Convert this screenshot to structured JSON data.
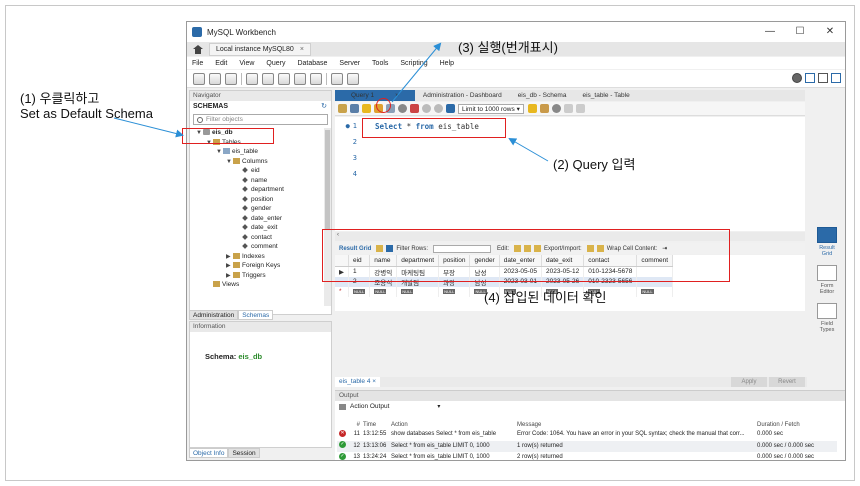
{
  "window": {
    "title": "MySQL Workbench",
    "controls": [
      "—",
      "☐",
      "✕"
    ]
  },
  "connection_tab": {
    "label": "Local instance MySQL80",
    "close": "×"
  },
  "menu": [
    "File",
    "Edit",
    "View",
    "Query",
    "Database",
    "Server",
    "Tools",
    "Scripting",
    "Help"
  ],
  "navigator": {
    "header": "Navigator",
    "schemas_label": "SCHEMAS",
    "filter_placeholder": "Filter objects",
    "tree": [
      {
        "label": "eis_db",
        "toggle": "▼",
        "icon": "db",
        "indent": 0,
        "bold": true
      },
      {
        "label": "Tables",
        "toggle": "▼",
        "icon": "folder",
        "indent": 1
      },
      {
        "label": "eis_table",
        "toggle": "▼",
        "icon": "table",
        "indent": 2
      },
      {
        "label": "Columns",
        "toggle": "▼",
        "icon": "folder",
        "indent": 3
      },
      {
        "label": "eid",
        "toggle": "",
        "icon": "column",
        "indent": 4
      },
      {
        "label": "name",
        "toggle": "",
        "icon": "column",
        "indent": 4
      },
      {
        "label": "department",
        "toggle": "",
        "icon": "column",
        "indent": 4
      },
      {
        "label": "position",
        "toggle": "",
        "icon": "column",
        "indent": 4
      },
      {
        "label": "gender",
        "toggle": "",
        "icon": "column",
        "indent": 4
      },
      {
        "label": "date_enter",
        "toggle": "",
        "icon": "column",
        "indent": 4
      },
      {
        "label": "date_exit",
        "toggle": "",
        "icon": "column",
        "indent": 4
      },
      {
        "label": "contact",
        "toggle": "",
        "icon": "column",
        "indent": 4
      },
      {
        "label": "comment",
        "toggle": "",
        "icon": "column",
        "indent": 4
      },
      {
        "label": "Indexes",
        "toggle": "▶",
        "icon": "folder",
        "indent": 3
      },
      {
        "label": "Foreign Keys",
        "toggle": "▶",
        "icon": "folder",
        "indent": 3
      },
      {
        "label": "Triggers",
        "toggle": "▶",
        "icon": "folder",
        "indent": 3
      },
      {
        "label": "Views",
        "toggle": "",
        "icon": "folder",
        "indent": 1
      }
    ],
    "tabs": [
      "Administration",
      "Schemas"
    ],
    "active_tab": "Schemas"
  },
  "information": {
    "header": "Information",
    "schema_label": "Schema:",
    "schema_value": "eis_db"
  },
  "bottom_tabs": [
    "Object Info",
    "Session"
  ],
  "editor_tabs": [
    {
      "label": "Query 1",
      "active": true,
      "close": "×"
    },
    {
      "label": "Administration - Dashboard",
      "active": false
    },
    {
      "label": "eis_db - Schema",
      "active": false
    },
    {
      "label": "eis_table - Table",
      "active": false
    }
  ],
  "query_toolbar": {
    "limit_label": "Limit to 1000 rows",
    "limit_caret": "▾"
  },
  "editor": {
    "line_numbers": [
      "1",
      "2",
      "3",
      "4"
    ],
    "marker": "●",
    "sql_keyword_1": "Select",
    "sql_star": "*",
    "sql_keyword_2": "from",
    "sql_table": "eis_table"
  },
  "result_bar": {
    "result_grid": "Result Grid",
    "filter_rows": "Filter Rows:",
    "edit": "Edit:",
    "export_import": "Export/Import:",
    "wrap": "Wrap Cell Content:",
    "wrap_glyph": "⇥"
  },
  "result_grid": {
    "columns": [
      "eid",
      "name",
      "department",
      "position",
      "gender",
      "date_enter",
      "date_exit",
      "contact",
      "comment"
    ],
    "rows": [
      [
        "1",
        "강병익",
        "마케팅팀",
        "부장",
        "남성",
        "2023-05-05",
        "2023-05-12",
        "010-1234-5678",
        ""
      ],
      [
        "2",
        "조용석",
        "개발팀",
        "과장",
        "남성",
        "2023-03-01",
        "2023-05-26",
        "010-2323-5656",
        ""
      ]
    ],
    "null_label": "NULL",
    "row_arrow": "▶",
    "new_row_marker": "*"
  },
  "side_panel": [
    {
      "label": "Result Grid",
      "active": true
    },
    {
      "label": "Form Editor",
      "active": false
    },
    {
      "label": "Field Types",
      "active": false
    }
  ],
  "result_tab": {
    "label": "eis_table 4",
    "close": "×",
    "apply": "Apply",
    "revert": "Revert"
  },
  "output": {
    "header": "Output",
    "selector": "Action Output",
    "selector_caret": "▾",
    "columns": [
      "#",
      "Time",
      "Action",
      "Message",
      "Duration / Fetch"
    ],
    "rows": [
      {
        "status": "error",
        "num": "11",
        "time": "13:12:55",
        "action": "show databases Select * from eis_table",
        "message": "Error Code: 1064. You have an error in your SQL syntax; check the manual that corr...",
        "duration": "0.000 sec"
      },
      {
        "status": "ok",
        "num": "12",
        "time": "13:13:06",
        "action": "Select * from eis_table LIMIT 0, 1000",
        "message": "1 row(s) returned",
        "duration": "0.000 sec / 0.000 sec"
      },
      {
        "status": "ok",
        "num": "13",
        "time": "13:24:24",
        "action": "Select * from eis_table LIMIT 0, 1000",
        "message": "2 row(s) returned",
        "duration": "0.000 sec / 0.000 sec"
      }
    ],
    "status_glyphs": {
      "error": "✕",
      "ok": "✓"
    }
  },
  "annotations": {
    "step1_line1": "(1) 우클릭하고",
    "step1_line2": "Set as Default Schema",
    "step2": "(2) Query 입력",
    "step3": "(3) 실행(번개표시)",
    "step4": "(4) 삽입된 데이터 확인"
  },
  "colors": {
    "accent": "#2b6aa8",
    "annotation_red": "#e02020",
    "ok_green": "#2e9a37",
    "error_red": "#c62828"
  }
}
